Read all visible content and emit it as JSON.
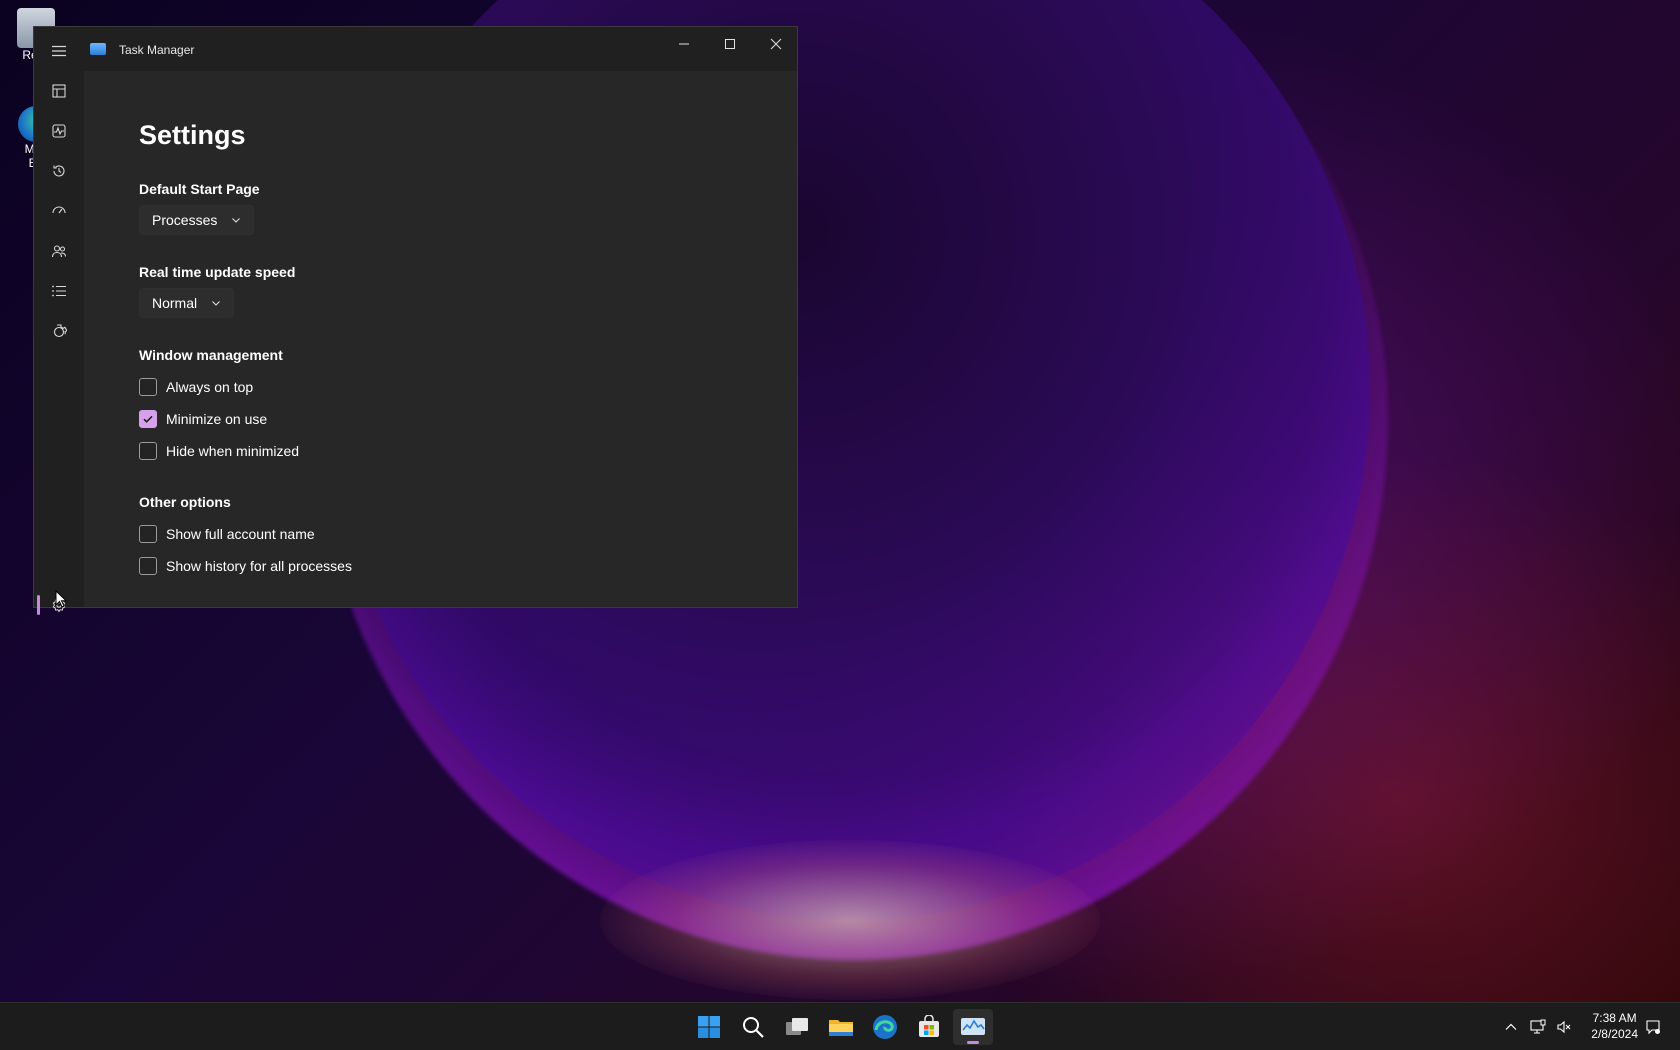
{
  "window": {
    "title": "Task Manager",
    "minimize_label": "—",
    "maximize_label": "☐",
    "close_label": "✕"
  },
  "nav": {
    "items": [
      {
        "icon": "hamburger-menu-icon"
      },
      {
        "icon": "processes-icon"
      },
      {
        "icon": "performance-icon"
      },
      {
        "icon": "app-history-icon"
      },
      {
        "icon": "startup-apps-icon"
      },
      {
        "icon": "users-icon"
      },
      {
        "icon": "details-icon"
      },
      {
        "icon": "services-icon"
      },
      {
        "icon": "settings-icon",
        "selected": true
      }
    ]
  },
  "settings": {
    "heading": "Settings",
    "default_start_page": {
      "label": "Default Start Page",
      "value": "Processes"
    },
    "update_speed": {
      "label": "Real time update speed",
      "value": "Normal"
    },
    "window_management": {
      "label": "Window management",
      "options": [
        {
          "label": "Always on top",
          "checked": false
        },
        {
          "label": "Minimize on use",
          "checked": true
        },
        {
          "label": "Hide when minimized",
          "checked": false
        }
      ]
    },
    "other_options": {
      "label": "Other options",
      "options": [
        {
          "label": "Show full account name",
          "checked": false
        },
        {
          "label": "Show history for all processes",
          "checked": false
        }
      ]
    }
  },
  "desktop": {
    "icons": [
      {
        "label": "Recy"
      },
      {
        "label": "Micr Ed"
      }
    ]
  },
  "taskbar": {
    "apps": [
      "start-icon",
      "search-icon",
      "task-view-icon",
      "file-explorer-icon",
      "edge-icon",
      "store-icon",
      "task-manager-icon"
    ],
    "time": "7:38 AM",
    "date": "2/8/2024"
  },
  "colors": {
    "accent": "#c58ae0",
    "window_bg": "#202020",
    "content_bg": "#272727"
  }
}
